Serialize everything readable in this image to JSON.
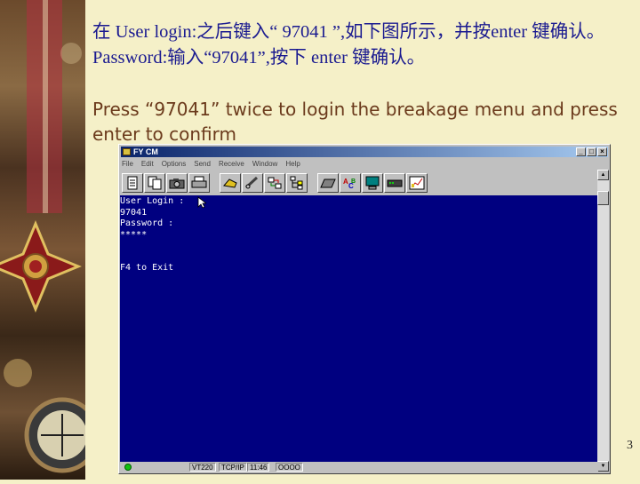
{
  "slide": {
    "cn_instruction": "在 User login:之后键入“ 97041 ”,如下图所示，并按enter 键确认。 Password:输入“97041”,按下 enter 键确认。",
    "en_instruction": "Press “97041” twice to login the breakage menu and press enter to confirm",
    "page_number": "3"
  },
  "window": {
    "title": "FY CM",
    "controls": {
      "minimize": "_",
      "maximize": "□",
      "close": "×"
    }
  },
  "menubar": {
    "items": [
      "File",
      "Edit",
      "Options",
      "Send",
      "Receive",
      "Window",
      "Help"
    ]
  },
  "toolbar": {
    "icons": [
      "doc-icon",
      "copy-icon",
      "camera-icon",
      "printer-icon",
      "phone-icon",
      "hangup-icon",
      "transfer-icon",
      "tree-icon",
      "keyboard-icon",
      "spellcheck-icon",
      "monitor-icon",
      "modem-icon",
      "chart-icon"
    ]
  },
  "terminal": {
    "lines": [
      "User Login :",
      "97041",
      "Password :",
      "*****",
      "",
      "",
      "F4 to Exit"
    ]
  },
  "statusbar": {
    "emulation": "VT220",
    "protocol": "TCP/IP",
    "time": "11:46",
    "indicators": "OOOO"
  },
  "colors": {
    "terminal_bg": "#000080",
    "terminal_fg": "#ffffff",
    "cn_text": "#1a1a90",
    "en_text": "#6b3a1c",
    "slide_bg": "#f5f0c8"
  }
}
